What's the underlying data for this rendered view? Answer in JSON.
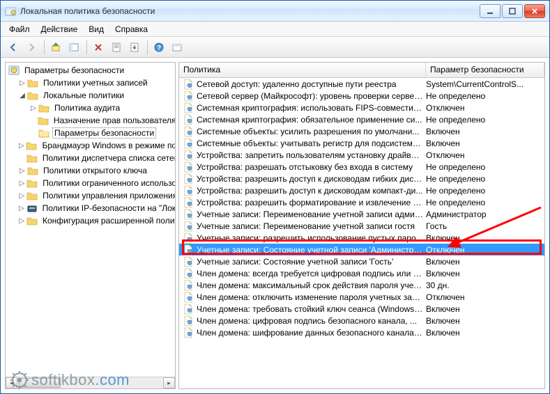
{
  "window": {
    "title": "Локальная политика безопасности"
  },
  "menu": {
    "file": "Файл",
    "action": "Действие",
    "view": "Вид",
    "help": "Справка"
  },
  "tree": {
    "root": "Параметры безопасности",
    "items": [
      {
        "expander": "▷",
        "indent": 14,
        "type": "folder",
        "label": "Политики учетных записей"
      },
      {
        "expander": "◢",
        "indent": 14,
        "type": "folder",
        "label": "Локальные политики"
      },
      {
        "expander": "▷",
        "indent": 30,
        "type": "folder",
        "label": "Политика аудита"
      },
      {
        "expander": "",
        "indent": 30,
        "type": "folder",
        "label": "Назначение прав пользователя"
      },
      {
        "expander": "",
        "indent": 30,
        "type": "folder-open",
        "label": "Параметры безопасности",
        "selected": true
      },
      {
        "expander": "▷",
        "indent": 14,
        "type": "folder",
        "label": "Брандмауэр Windows в режиме пов"
      },
      {
        "expander": "",
        "indent": 14,
        "type": "folder",
        "label": "Политики диспетчера списка сетей"
      },
      {
        "expander": "▷",
        "indent": 14,
        "type": "folder",
        "label": "Политики открытого ключа"
      },
      {
        "expander": "▷",
        "indent": 14,
        "type": "folder",
        "label": "Политики ограниченного использо"
      },
      {
        "expander": "▷",
        "indent": 14,
        "type": "folder",
        "label": "Политики управления приложения"
      },
      {
        "expander": "▷",
        "indent": 14,
        "type": "ip",
        "label": "Политики IP-безопасности на \"Лока"
      },
      {
        "expander": "▷",
        "indent": 14,
        "type": "folder",
        "label": "Конфигурация расширенной полит"
      }
    ]
  },
  "list": {
    "headers": {
      "policy": "Политика",
      "param": "Параметр безопасности"
    },
    "rows": [
      {
        "policy": "Сетевой доступ: удаленно доступные пути реестра",
        "param": "System\\CurrentControlS..."
      },
      {
        "policy": "Сетевой сервер (Майкрософт): уровень проверки сервер...",
        "param": "Не определено"
      },
      {
        "policy": "Системная криптография: использовать FIPS-совместим...",
        "param": "Отключен"
      },
      {
        "policy": "Системная криптография: обязательное применение си...",
        "param": "Не определено"
      },
      {
        "policy": "Системные объекты: усилить разрешения по умолчани...",
        "param": "Включен"
      },
      {
        "policy": "Системные объекты: учитывать регистр для подсистем, ...",
        "param": "Включен"
      },
      {
        "policy": "Устройства: запретить пользователям установку драйвер...",
        "param": "Отключен"
      },
      {
        "policy": "Устройства: разрешать отстыковку без входа в систему",
        "param": "Не определено"
      },
      {
        "policy": "Устройства: разрешить доступ к дисководам гибких диск...",
        "param": "Не определено"
      },
      {
        "policy": "Устройства: разрешить доступ к дисководам компакт-ди...",
        "param": "Не определено"
      },
      {
        "policy": "Устройства: разрешить форматирование и извлечение с...",
        "param": "Не определено"
      },
      {
        "policy": "Учетные записи: Переименование учетной записи админ...",
        "param": "Администратор"
      },
      {
        "policy": "Учетные записи: Переименование учетной записи гостя",
        "param": "Гость"
      },
      {
        "policy": "Учетные записи: разрешить использование пустых паро...",
        "param": "Включен"
      },
      {
        "policy": "Учетные записи: Состояние учетной записи 'Администра...",
        "param": "Отключен",
        "selected": true
      },
      {
        "policy": "Учетные записи: Состояние учетной записи 'Гость'",
        "param": "Включен"
      },
      {
        "policy": "Член домена: всегда требуется цифровая подпись или ш...",
        "param": "Включен"
      },
      {
        "policy": "Член домена: максимальный срок действия пароля учет...",
        "param": "30 дн."
      },
      {
        "policy": "Член домена: отключить изменение пароля учетных зап...",
        "param": "Отключен"
      },
      {
        "policy": "Член домена: требовать стойкий ключ сеанса (Windows ...",
        "param": "Включен"
      },
      {
        "policy": "Член домена: цифровая подпись безопасного канала, ...",
        "param": "Включен"
      },
      {
        "policy": "Член домена: шифрование данных безопасного канала, ...",
        "param": "Включен"
      }
    ]
  },
  "watermark": {
    "a": "softikbox",
    "b": ".com"
  }
}
